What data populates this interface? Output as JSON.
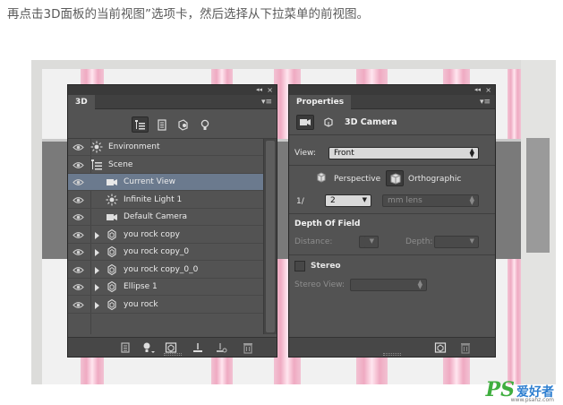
{
  "instruction": "再点击3D面板的当前视图”选项卡，然后选择从下拉菜单的前视图。",
  "panel_3d": {
    "tab": "3D",
    "layers": [
      {
        "label": "Environment",
        "icon": "environment-icon",
        "indent": 0,
        "expand": false
      },
      {
        "label": "Scene",
        "icon": "scene-icon",
        "indent": 0,
        "expand": false
      },
      {
        "label": "Current View",
        "icon": "current-view-camera-icon",
        "indent": 1,
        "expand": false,
        "selected": true
      },
      {
        "label": "Infinite Light 1",
        "icon": "infinite-light-icon",
        "indent": 1,
        "expand": false
      },
      {
        "label": "Default Camera",
        "icon": "camera-icon",
        "indent": 1,
        "expand": false
      },
      {
        "label": "you rock copy",
        "icon": "mesh-icon",
        "indent": 1,
        "expand": true
      },
      {
        "label": "you rock copy_0",
        "icon": "mesh-icon",
        "indent": 1,
        "expand": true
      },
      {
        "label": "you rock copy_0_0",
        "icon": "mesh-icon",
        "indent": 1,
        "expand": true
      },
      {
        "label": "Ellipse 1",
        "icon": "mesh-icon",
        "indent": 1,
        "expand": true
      },
      {
        "label": "you rock",
        "icon": "mesh-icon",
        "indent": 1,
        "expand": true
      }
    ]
  },
  "properties": {
    "tab": "Properties",
    "title": "3D Camera",
    "view_label": "View:",
    "view_value": "Front",
    "perspective_label": "Perspective",
    "orthographic_label": "Orthographic",
    "fraction_prefix": "1/",
    "lens_value": "2",
    "lens_units": "mm lens",
    "dof_title": "Depth Of Field",
    "distance_label": "Distance:",
    "depth_label": "Depth:",
    "stereo_label": "Stereo",
    "stereo_view_label": "Stereo View:"
  },
  "watermark": {
    "logo": "PS",
    "chinese": "爱好者",
    "url": "www.psahz.com"
  }
}
